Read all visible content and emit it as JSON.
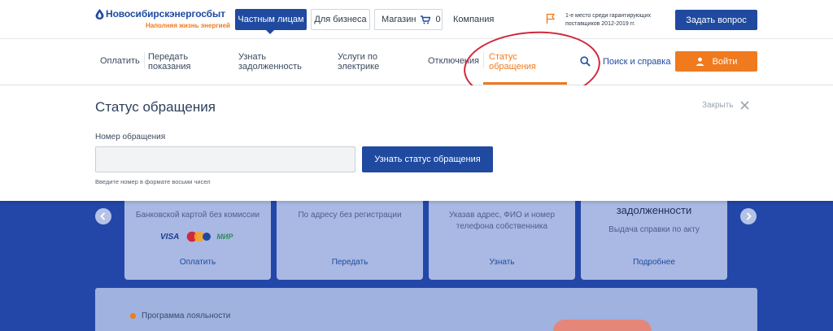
{
  "brand": {
    "name": "Новосибирскэнергосбыт",
    "slogan": "Наполняя жизнь энергией",
    "logo_icon": "drop-logo-icon"
  },
  "topbar": {
    "private_label": "Частным лицам",
    "business_label": "Для бизнеса",
    "shop_label": "Магазин",
    "cart_count": "0",
    "company_label": "Компания",
    "award_text": "1-е место среди гарантирующих поставщиков 2012-2019 гг.",
    "ask_button": "Задать вопрос"
  },
  "nav": {
    "items": [
      {
        "label": "Оплатить"
      },
      {
        "label": "Передать показания"
      },
      {
        "label": "Узнать задолженность"
      },
      {
        "label": "Услуги по электрике"
      },
      {
        "label": "Отключения"
      },
      {
        "label": "Статус обращения"
      }
    ],
    "search_label": "Поиск и справка",
    "login_button": "Войти"
  },
  "panel": {
    "title": "Статус обращения",
    "close_label": "Закрыть",
    "field_label": "Номер обращения",
    "field_value": "",
    "field_placeholder": "",
    "submit_button": "Узнать статус обращения",
    "hint": "Введите номер в формате восьми чисел"
  },
  "cards": [
    {
      "desc": "Банковской картой без комиссии",
      "link": "Оплатить",
      "payment_logos": [
        "VISA",
        "mastercard",
        "МИР"
      ]
    },
    {
      "desc": "По адресу без регистрации",
      "link": "Передать"
    },
    {
      "desc": "Указав адрес, ФИО и номер телефона собственника",
      "link": "Узнать"
    },
    {
      "title": "задолженности",
      "desc": "Выдача справки по акту",
      "link": "Подробнее"
    }
  ],
  "promo": {
    "label": "Программа лояльности"
  },
  "colors": {
    "primary_blue": "#1f4aa0",
    "accent_orange": "#f07a1e",
    "section_blue": "#2347a8",
    "annotation_red": "#d0283c"
  }
}
